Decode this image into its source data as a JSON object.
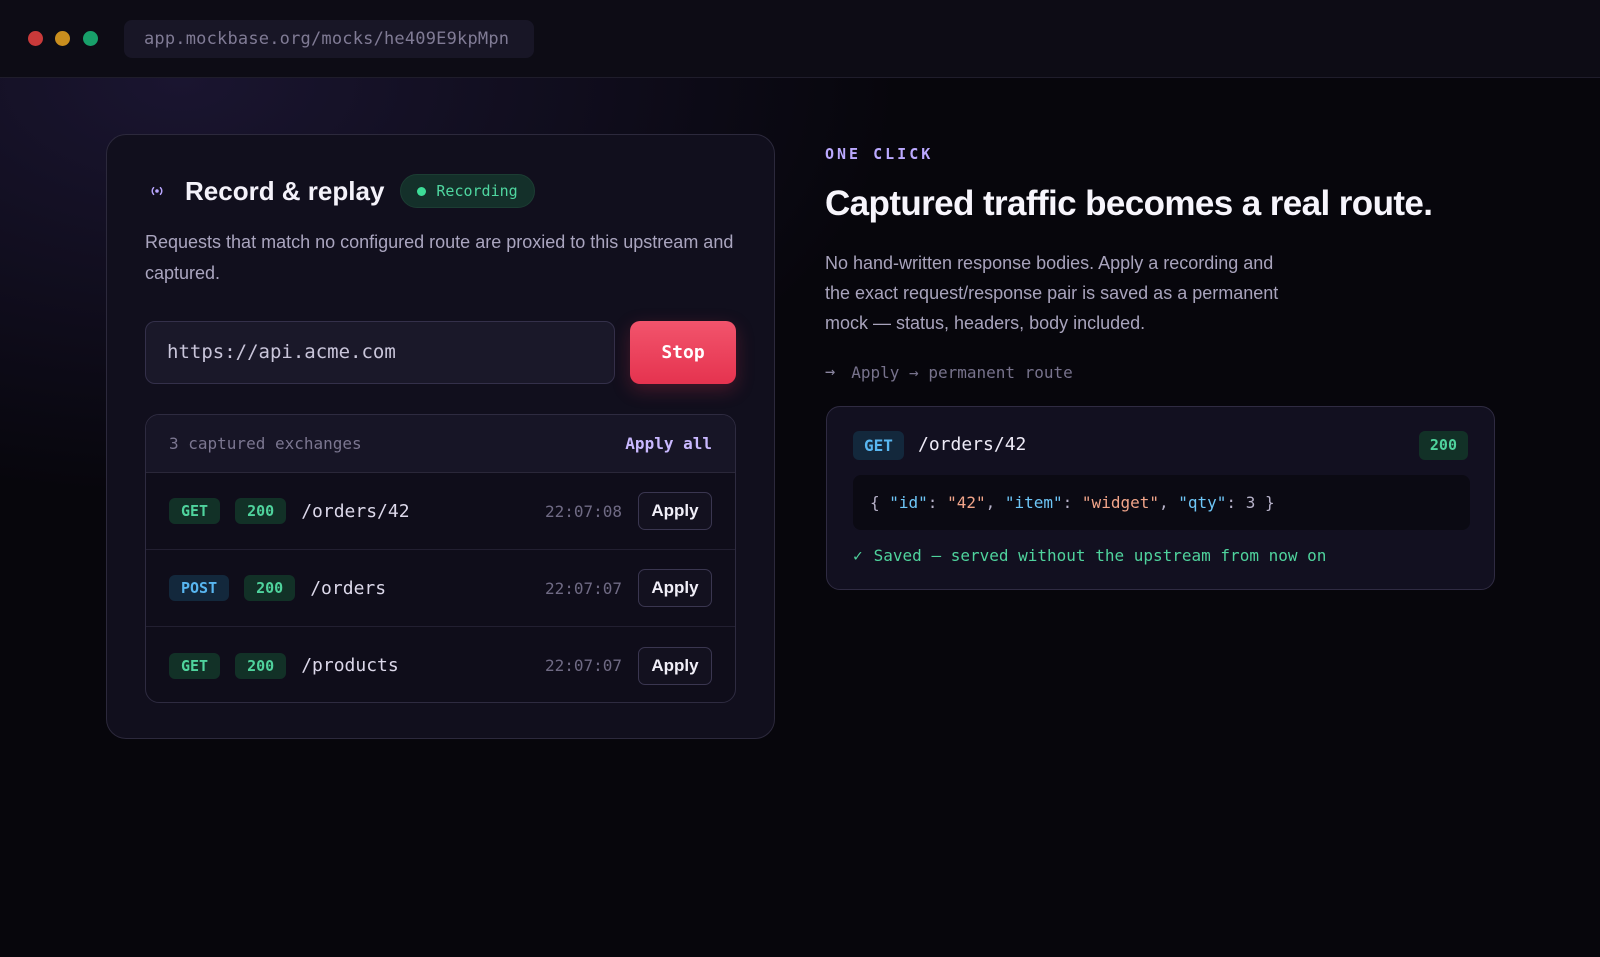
{
  "window": {
    "url": "app.mockbase.org/mocks/he409E9kpMpn",
    "colors": {
      "close": "#c93a3a",
      "minimize": "#c98e1e",
      "maximize": "#18a06a"
    }
  },
  "recorder": {
    "icon": "broadcast-icon",
    "title": "Record & replay",
    "status_badge": "Recording",
    "description": "Requests that match no configured route are proxied to this upstream and captured.",
    "upstream_url": "https://api.acme.com",
    "stop_label": "Stop",
    "captured_count": "3 captured exchanges",
    "apply_all_label": "Apply all",
    "exchanges": [
      {
        "method": "GET",
        "status": "200",
        "path": "/orders/42",
        "time": "22:07:08",
        "apply_label": "Apply"
      },
      {
        "method": "POST",
        "status": "200",
        "path": "/orders",
        "time": "22:07:07",
        "apply_label": "Apply"
      },
      {
        "method": "GET",
        "status": "200",
        "path": "/products",
        "time": "22:07:07",
        "apply_label": "Apply"
      }
    ]
  },
  "promo": {
    "eyebrow": "ONE CLICK",
    "headline": "Captured traffic becomes a real route.",
    "body": "No hand-written response bodies. Apply a recording and the exact request/response pair is saved as a permanent mock — status, headers, body included.",
    "flow_text": "Apply → permanent route"
  },
  "route_card": {
    "method": "GET",
    "path": "/orders/42",
    "status": "200",
    "body_tokens": [
      {
        "t": "{ ",
        "k": "p"
      },
      {
        "t": "\"id\"",
        "k": "key"
      },
      {
        "t": ": ",
        "k": "p"
      },
      {
        "t": "\"42\"",
        "k": "str"
      },
      {
        "t": ", ",
        "k": "p"
      },
      {
        "t": "\"item\"",
        "k": "key"
      },
      {
        "t": ": ",
        "k": "p"
      },
      {
        "t": "\"widget\"",
        "k": "str"
      },
      {
        "t": ", ",
        "k": "p"
      },
      {
        "t": "\"qty\"",
        "k": "key"
      },
      {
        "t": ": 3 }",
        "k": "p"
      }
    ],
    "saved_text": "Saved — served without the upstream from now on"
  },
  "theme": {
    "accent": "#bba9ff",
    "danger": "#e5334f",
    "success": "#4fd39d",
    "info": "#58b6f0"
  }
}
